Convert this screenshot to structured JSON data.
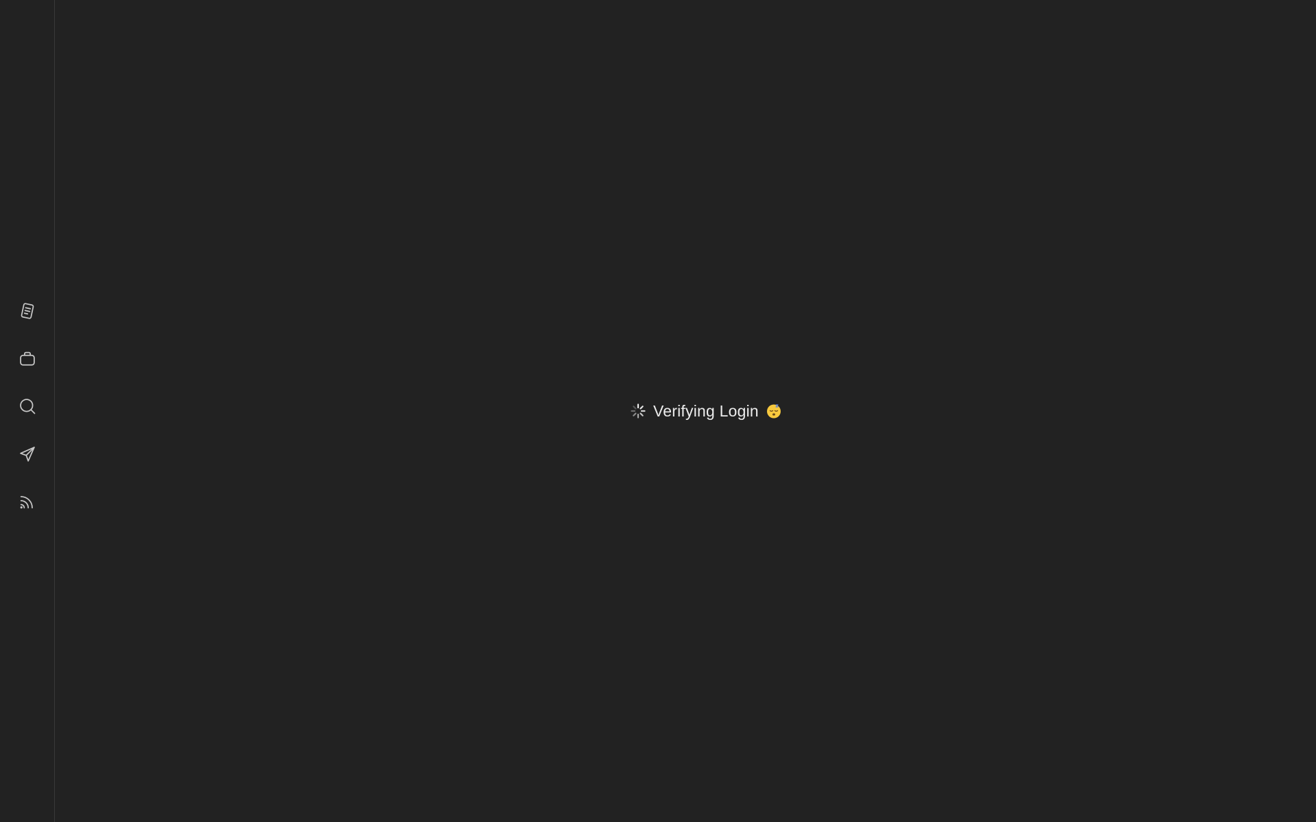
{
  "sidebar": {
    "items": [
      {
        "icon": "document-icon",
        "name": "nav-item-documents"
      },
      {
        "icon": "briefcase-icon",
        "name": "nav-item-jobs"
      },
      {
        "icon": "search-icon",
        "name": "nav-item-search"
      },
      {
        "icon": "send-icon",
        "name": "nav-item-send"
      },
      {
        "icon": "rss-feed-icon",
        "name": "nav-item-feed"
      }
    ]
  },
  "main": {
    "loading_text": "Verifying Login",
    "loading_emoji": "sleeping-face-emoji",
    "spinner_icon": "loading-spinner-icon"
  },
  "colors": {
    "background": "#222222",
    "sidebar_border": "#3a3a3a",
    "text": "#ececec",
    "icon_stroke": "#c8c8c8",
    "emoji_face": "#f7c93e"
  }
}
